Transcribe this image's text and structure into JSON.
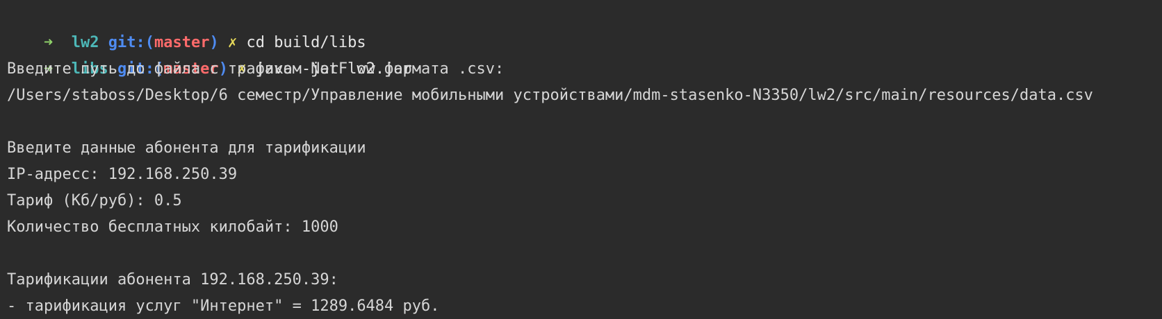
{
  "colors": {
    "background": "#2b2b2b",
    "text": "#d6d6d6",
    "prompt_arrow": "#8fd16a",
    "directory": "#4db8b8",
    "git_label": "#4f8cf2",
    "branch": "#ff6b6b",
    "dirty_mark": "#e6d95a"
  },
  "prompts": [
    {
      "arrow": "➜",
      "dir": "lw2",
      "git_prefix": "git:(",
      "branch": "master",
      "git_suffix": ")",
      "dirty": "✗",
      "command": "cd build/libs"
    },
    {
      "arrow": "➜",
      "dir": "libs",
      "git_prefix": "git:(",
      "branch": "master",
      "git_suffix": ")",
      "dirty": "✗",
      "command": "java -jar lw2.jar"
    }
  ],
  "output": [
    "Введите путь до файла с трафиком NetFlow формата .csv:",
    "/Users/staboss/Desktop/6 семестр/Управление мобильными устройствами/mdm-stasenko-N3350/lw2/src/main/resources/data.csv",
    "",
    "Введите данные абонента для тарификации",
    "IP-адресс: 192.168.250.39",
    "Тариф (Кб/руб): 0.5",
    "Количество бесплатных килобайт: 1000",
    "",
    "Тарификации абонента 192.168.250.39:",
    "- тарификация услуг \"Интернет\" = 1289.6484 руб."
  ]
}
